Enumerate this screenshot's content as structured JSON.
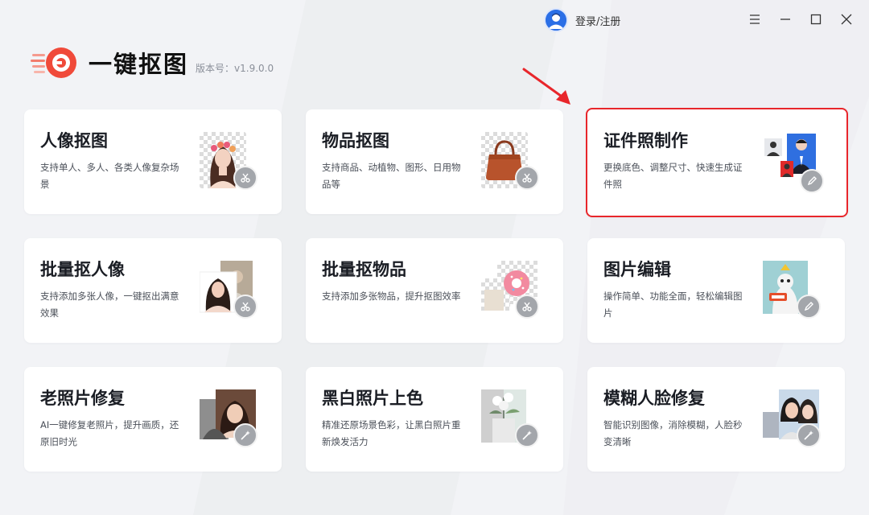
{
  "header": {
    "user_label": "登录/注册"
  },
  "app": {
    "name": "一键抠图",
    "version": "版本号：v1.9.0.0"
  },
  "colors": {
    "accent_red": "#e8262b",
    "logo_red": "#f04a3a",
    "avatar_blue": "#2b6fe6"
  },
  "cards": [
    {
      "title": "人像抠图",
      "desc": "支持单人、多人、各类人像复杂场景",
      "badge_icon": "scissors-icon"
    },
    {
      "title": "物品抠图",
      "desc": "支持商品、动植物、图形、日用物品等",
      "badge_icon": "scissors-icon"
    },
    {
      "title": "证件照制作",
      "desc": "更换底色、调整尺寸、快速生成证件照",
      "badge_icon": "pencil-icon"
    },
    {
      "title": "批量抠人像",
      "desc": "支持添加多张人像，一键抠出满意效果",
      "badge_icon": "scissors-icon"
    },
    {
      "title": "批量抠物品",
      "desc": "支持添加多张物品，提升抠图效率",
      "badge_icon": "scissors-icon"
    },
    {
      "title": "图片编辑",
      "desc": "操作简单、功能全面，轻松编辑图片",
      "badge_icon": "pencil-icon"
    },
    {
      "title": "老照片修复",
      "desc": "AI一键修复老照片，提升画质，还原旧时光",
      "badge_icon": "wand-icon"
    },
    {
      "title": "黑白照片上色",
      "desc": "精准还原场景色彩，让黑白照片重新焕发活力",
      "badge_icon": "wand-icon"
    },
    {
      "title": "模糊人脸修复",
      "desc": "智能识别图像，消除模糊，人脸秒变清晰",
      "badge_icon": "wand-icon"
    }
  ]
}
